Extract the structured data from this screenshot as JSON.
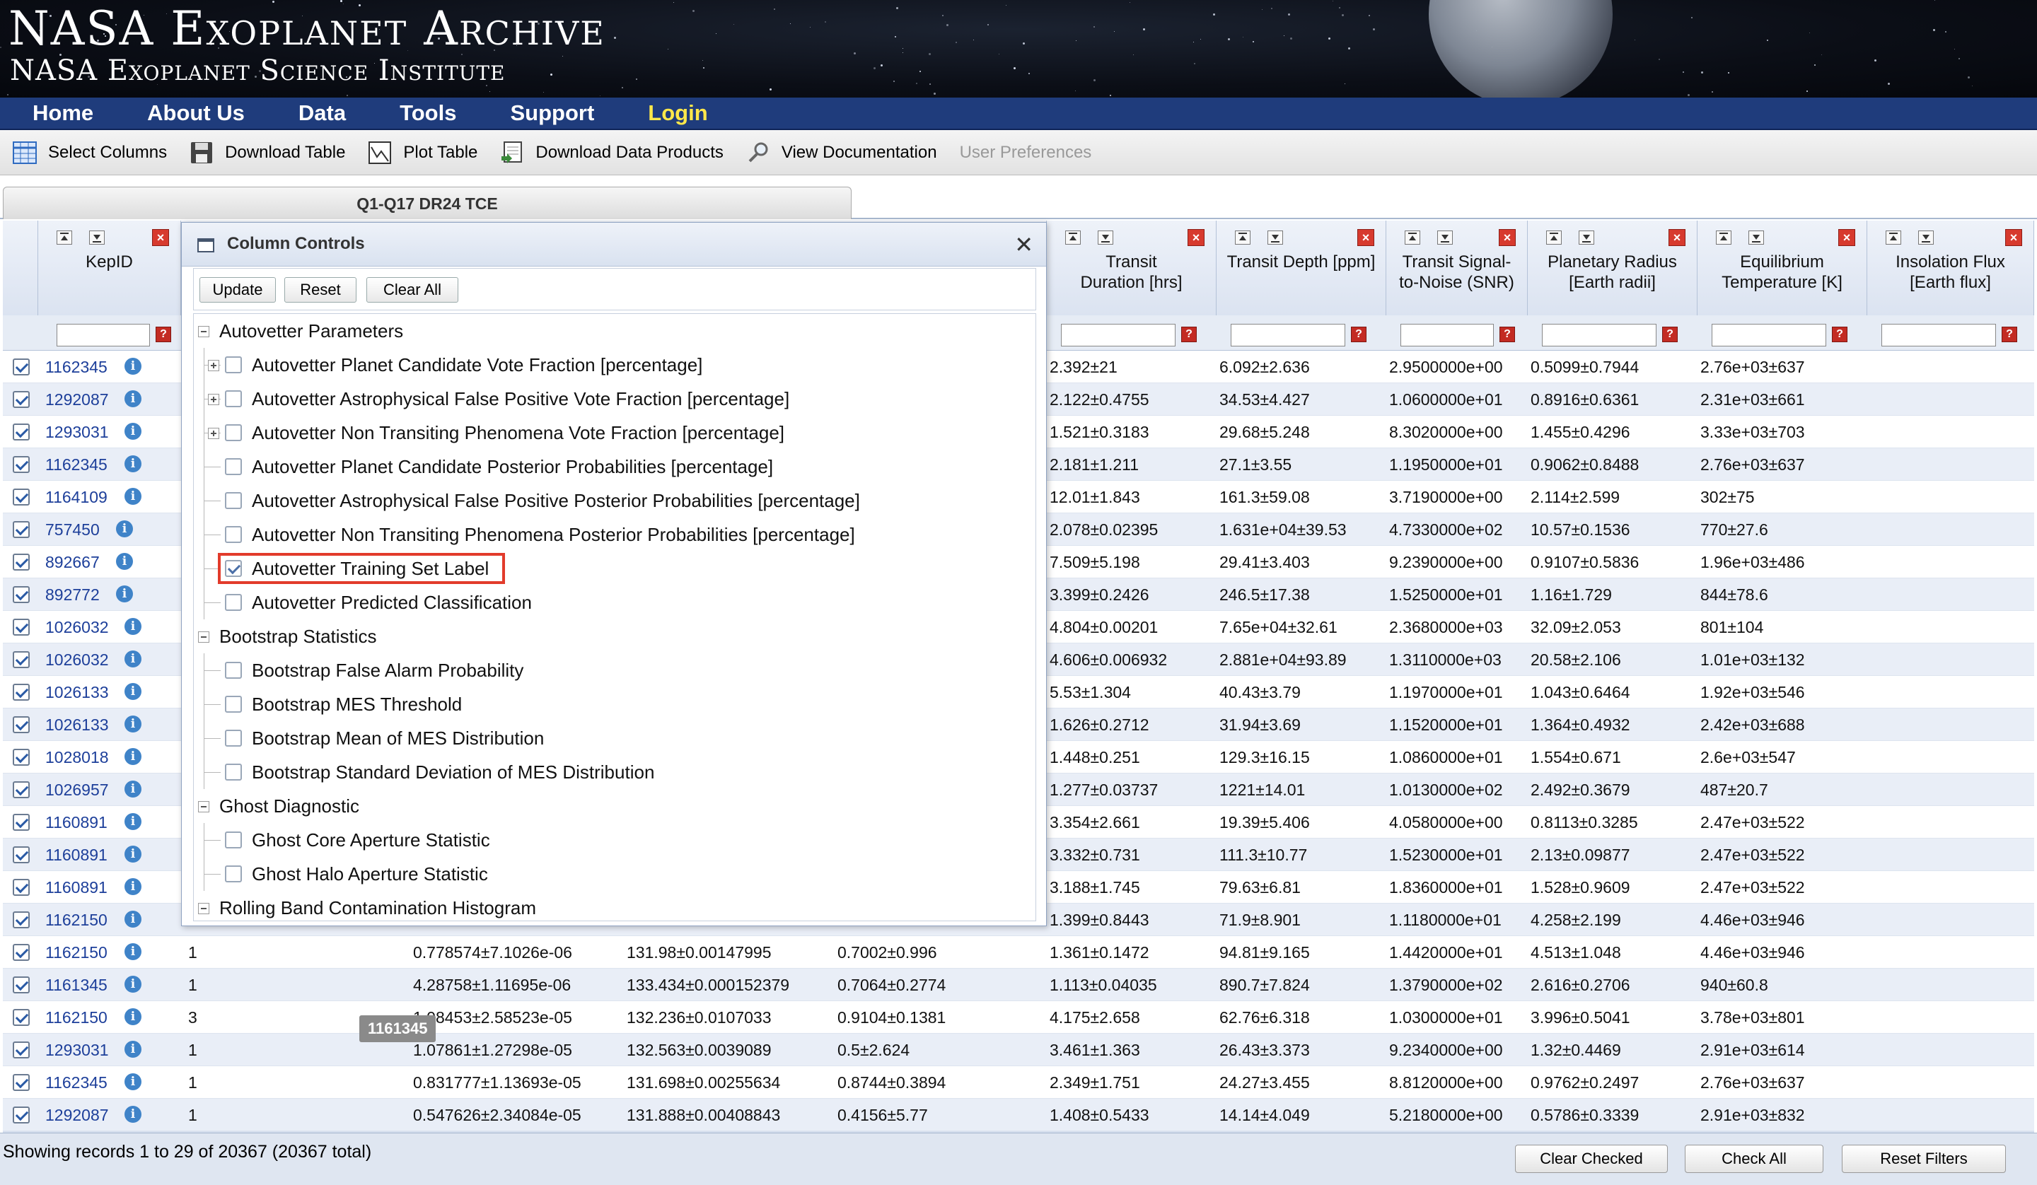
{
  "banner": {
    "title": "NASA Exoplanet Archive",
    "subtitle": "NASA Exoplanet Science Institute"
  },
  "nav": [
    "Home",
    "About Us",
    "Data",
    "Tools",
    "Support",
    "Login"
  ],
  "toolbar": [
    {
      "label": "Select Columns",
      "icon": "table-grid-icon"
    },
    {
      "label": "Download Table",
      "icon": "floppy-disk-icon"
    },
    {
      "label": "Plot Table",
      "icon": "plot-icon"
    },
    {
      "label": "Download Data Products",
      "icon": "download-products-icon"
    },
    {
      "label": "View Documentation",
      "icon": "magnifier-icon"
    },
    {
      "label": "User Preferences",
      "icon": ""
    }
  ],
  "tab": "Q1-Q17 DR24 TCE",
  "columns": {
    "kepid": "KepID",
    "right": [
      "Transit Duration [hrs]",
      "Transit Depth [ppm]",
      "Transit Signal-to-Noise (SNR)",
      "Planetary Radius [Earth radii]",
      "Equilibrium Temperature [K]",
      "Insolation Flux [Earth flux]"
    ]
  },
  "rows": [
    {
      "kepid": "1162345",
      "c1": "",
      "c3": "",
      "c4": "",
      "c5": "",
      "dur": "2.392±21",
      "depth": "6.092±2.636",
      "snr": "2.9500000e+00",
      "rad": "0.5099±0.7944",
      "teq": "2.76e+03±637"
    },
    {
      "kepid": "1292087",
      "c1": "",
      "c3": "",
      "c4": "",
      "c5": "",
      "dur": "2.122±0.4755",
      "depth": "34.53±4.427",
      "snr": "1.0600000e+01",
      "rad": "0.8916±0.6361",
      "teq": "2.31e+03±661"
    },
    {
      "kepid": "1293031",
      "c1": "",
      "c3": "",
      "c4": "",
      "c5": "",
      "dur": "1.521±0.3183",
      "depth": "29.68±5.248",
      "snr": "8.3020000e+00",
      "rad": "1.455±0.4296",
      "teq": "3.33e+03±703"
    },
    {
      "kepid": "1162345",
      "c1": "",
      "c3": "",
      "c4": "",
      "c5": "",
      "dur": "2.181±1.211",
      "depth": "27.1±3.55",
      "snr": "1.1950000e+01",
      "rad": "0.9062±0.8488",
      "teq": "2.76e+03±637"
    },
    {
      "kepid": "1164109",
      "c1": "",
      "c3": "",
      "c4": "",
      "c5": "",
      "dur": "12.01±1.843",
      "depth": "161.3±59.08",
      "snr": "3.7190000e+00",
      "rad": "2.114±2.599",
      "teq": "302±75"
    },
    {
      "kepid": "757450",
      "c1": "",
      "c3": "",
      "c4": "",
      "c5": "",
      "dur": "2.078±0.02395",
      "depth": "1.631e+04±39.53",
      "snr": "4.7330000e+02",
      "rad": "10.57±0.1536",
      "teq": "770±27.6"
    },
    {
      "kepid": "892667",
      "c1": "",
      "c3": "",
      "c4": "",
      "c5": "",
      "dur": "7.509±5.198",
      "depth": "29.41±3.403",
      "snr": "9.2390000e+00",
      "rad": "0.9107±0.5836",
      "teq": "1.96e+03±486"
    },
    {
      "kepid": "892772",
      "c1": "",
      "c3": "",
      "c4": "",
      "c5": "",
      "dur": "3.399±0.2426",
      "depth": "246.5±17.38",
      "snr": "1.5250000e+01",
      "rad": "1.16±1.729",
      "teq": "844±78.6"
    },
    {
      "kepid": "1026032",
      "c1": "",
      "c3": "",
      "c4": "",
      "c5": "",
      "dur": "4.804±0.00201",
      "depth": "7.65e+04±32.61",
      "snr": "2.3680000e+03",
      "rad": "32.09±2.053",
      "teq": "801±104"
    },
    {
      "kepid": "1026032",
      "c1": "",
      "c3": "",
      "c4": "",
      "c5": "",
      "dur": "4.606±0.006932",
      "depth": "2.881e+04±93.89",
      "snr": "1.3110000e+03",
      "rad": "20.58±2.106",
      "teq": "1.01e+03±132"
    },
    {
      "kepid": "1026133",
      "c1": "",
      "c3": "",
      "c4": "",
      "c5": "",
      "dur": "5.53±1.304",
      "depth": "40.43±3.79",
      "snr": "1.1970000e+01",
      "rad": "1.043±0.6464",
      "teq": "1.92e+03±546"
    },
    {
      "kepid": "1026133",
      "c1": "",
      "c3": "",
      "c4": "",
      "c5": "",
      "dur": "1.626±0.2712",
      "depth": "31.94±3.69",
      "snr": "1.1520000e+01",
      "rad": "1.364±0.4932",
      "teq": "2.42e+03±688"
    },
    {
      "kepid": "1028018",
      "c1": "",
      "c3": "",
      "c4": "",
      "c5": "",
      "dur": "1.448±0.251",
      "depth": "129.3±16.15",
      "snr": "1.0860000e+01",
      "rad": "1.554±0.671",
      "teq": "2.6e+03±547"
    },
    {
      "kepid": "1026957",
      "c1": "",
      "c3": "",
      "c4": "",
      "c5": "",
      "dur": "1.277±0.03737",
      "depth": "1221±14.01",
      "snr": "1.0130000e+02",
      "rad": "2.492±0.3679",
      "teq": "487±20.7"
    },
    {
      "kepid": "1160891",
      "c1": "",
      "c3": "",
      "c4": "",
      "c5": "",
      "dur": "3.354±2.661",
      "depth": "19.39±5.406",
      "snr": "4.0580000e+00",
      "rad": "0.8113±0.3285",
      "teq": "2.47e+03±522"
    },
    {
      "kepid": "1160891",
      "c1": "",
      "c3": "",
      "c4": "",
      "c5": "",
      "dur": "3.332±0.731",
      "depth": "111.3±10.77",
      "snr": "1.5230000e+01",
      "rad": "2.13±0.09877",
      "teq": "2.47e+03±522"
    },
    {
      "kepid": "1160891",
      "c1": "",
      "c3": "",
      "c4": "",
      "c5": "",
      "dur": "3.188±1.745",
      "depth": "79.63±6.81",
      "snr": "1.8360000e+01",
      "rad": "1.528±0.9609",
      "teq": "2.47e+03±522"
    },
    {
      "kepid": "1162150",
      "c1": "",
      "c3": "",
      "c4": "",
      "c5": "",
      "dur": "1.399±0.8443",
      "depth": "71.9±8.901",
      "snr": "1.1180000e+01",
      "rad": "4.258±2.199",
      "teq": "4.46e+03±946"
    },
    {
      "kepid": "1162150",
      "c1": "1",
      "c3": "0.778574±7.1026e-06",
      "c4": "131.98±0.00147995",
      "c5": "0.7002±0.996",
      "dur": "1.361±0.1472",
      "depth": "94.81±9.165",
      "snr": "1.4420000e+01",
      "rad": "4.513±1.048",
      "teq": "4.46e+03±946"
    },
    {
      "kepid": "1161345",
      "c1": "1",
      "c3": "4.28758±1.11695e-06",
      "c4": "133.434±0.000152379",
      "c5": "0.7064±0.2774",
      "dur": "1.113±0.04035",
      "depth": "890.7±7.824",
      "snr": "1.3790000e+02",
      "rad": "2.616±0.2706",
      "teq": "940±60.8"
    },
    {
      "kepid": "1162150",
      "c1": "3",
      "c3": "1.08453±2.58523e-05",
      "c4": "132.236±0.0107033",
      "c5": "0.9104±0.1381",
      "dur": "4.175±2.658",
      "depth": "62.76±6.318",
      "snr": "1.0300000e+01",
      "rad": "3.996±0.5041",
      "teq": "3.78e+03±801"
    },
    {
      "kepid": "1293031",
      "c1": "1",
      "c3": "1.07861±1.27298e-05",
      "c4": "132.563±0.0039089",
      "c5": "0.5±2.624",
      "dur": "3.461±1.363",
      "depth": "26.43±3.373",
      "snr": "9.2340000e+00",
      "rad": "1.32±0.4469",
      "teq": "2.91e+03±614"
    },
    {
      "kepid": "1162345",
      "c1": "1",
      "c3": "0.831777±1.13693e-05",
      "c4": "131.698±0.00255634",
      "c5": "0.8744±0.3894",
      "dur": "2.349±1.751",
      "depth": "24.27±3.455",
      "snr": "8.8120000e+00",
      "rad": "0.9762±0.2497",
      "teq": "2.76e+03±637"
    },
    {
      "kepid": "1292087",
      "c1": "1",
      "c3": "0.547626±2.34084e-05",
      "c4": "131.888±0.00408843",
      "c5": "0.4156±5.77",
      "dur": "1.408±0.5433",
      "depth": "14.14±4.049",
      "snr": "5.2180000e+00",
      "rad": "0.5786±0.3339",
      "teq": "2.91e+03±832"
    }
  ],
  "tooltip": "1161345",
  "panel": {
    "title": "Column Controls",
    "buttons": [
      "Update",
      "Reset",
      "Clear All"
    ],
    "tree": [
      {
        "label": "Autovetter Parameters",
        "level": 0,
        "expander": "minus"
      },
      {
        "label": "Autovetter Planet Candidate Vote Fraction [percentage]",
        "level": 1,
        "expander": "plus",
        "checked": false
      },
      {
        "label": "Autovetter Astrophysical False Positive Vote Fraction [percentage]",
        "level": 1,
        "expander": "plus",
        "checked": false
      },
      {
        "label": "Autovetter Non Transiting Phenomena Vote Fraction [percentage]",
        "level": 1,
        "expander": "plus",
        "checked": false
      },
      {
        "label": "Autovetter Planet Candidate Posterior Probabilities [percentage]",
        "level": 1,
        "expander": "",
        "checked": false
      },
      {
        "label": "Autovetter Astrophysical False Positive Posterior Probabilities [percentage]",
        "level": 1,
        "expander": "",
        "checked": false
      },
      {
        "label": "Autovetter Non Transiting Phenomena Posterior Probabilities [percentage]",
        "level": 1,
        "expander": "",
        "checked": false
      },
      {
        "label": "Autovetter Training Set Label",
        "level": 1,
        "expander": "",
        "checked": true,
        "highlight": true
      },
      {
        "label": "Autovetter Predicted Classification",
        "level": 1,
        "expander": "",
        "checked": false
      },
      {
        "label": "Bootstrap Statistics",
        "level": 0,
        "expander": "minus"
      },
      {
        "label": "Bootstrap False Alarm Probability",
        "level": 1,
        "expander": "",
        "checked": false
      },
      {
        "label": "Bootstrap MES Threshold",
        "level": 1,
        "expander": "",
        "checked": false
      },
      {
        "label": "Bootstrap Mean of MES Distribution",
        "level": 1,
        "expander": "",
        "checked": false
      },
      {
        "label": "Bootstrap Standard Deviation of MES Distribution",
        "level": 1,
        "expander": "",
        "checked": false
      },
      {
        "label": "Ghost Diagnostic",
        "level": 0,
        "expander": "minus"
      },
      {
        "label": "Ghost Core Aperture Statistic",
        "level": 1,
        "expander": "",
        "checked": false
      },
      {
        "label": "Ghost Halo Aperture Statistic",
        "level": 1,
        "expander": "",
        "checked": false
      },
      {
        "label": "Rolling Band Contamination Histogram",
        "level": 0,
        "expander": "minus"
      }
    ]
  },
  "footer": {
    "records": "Showing records 1 to 29 of 20367 (20367 total)",
    "buttons": [
      "Clear Checked",
      "Check All",
      "Reset Filters"
    ]
  }
}
